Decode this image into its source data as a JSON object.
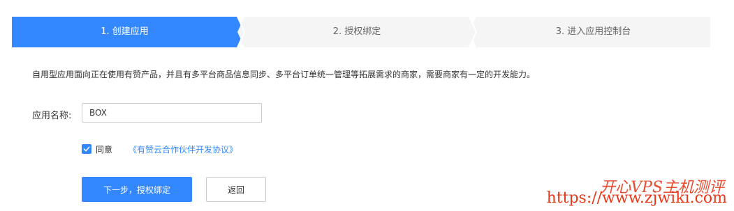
{
  "steps": [
    {
      "label": "1. 创建应用",
      "state": "active"
    },
    {
      "label": "2. 授权绑定",
      "state": "inactive"
    },
    {
      "label": "3. 进入应用控制台",
      "state": "inactive"
    }
  ],
  "colors": {
    "primary": "#3388ff",
    "step_inactive_bg": "#f5f5f5",
    "step_separator": "#ffffff",
    "watermark": "#e8391a"
  },
  "description": "自用型应用面向正在使用有赞产品，并且有多平台商品信息同步、多平台订单统一管理等拓展需求的商家，需要商家有一定的开发能力。",
  "form": {
    "app_name_label": "应用名称:",
    "app_name_value": "BOX",
    "agree": {
      "checked": true,
      "label": "同意",
      "link_text": "《有赞云合作伙伴开发协议》"
    }
  },
  "buttons": {
    "next_label": "下一步，授权绑定",
    "back_label": "返回"
  },
  "watermark": {
    "url_text": "https://www.zjwiki.com",
    "script_text": "开心VPS主机测评"
  },
  "icons": {
    "checkbox": "check-icon"
  }
}
